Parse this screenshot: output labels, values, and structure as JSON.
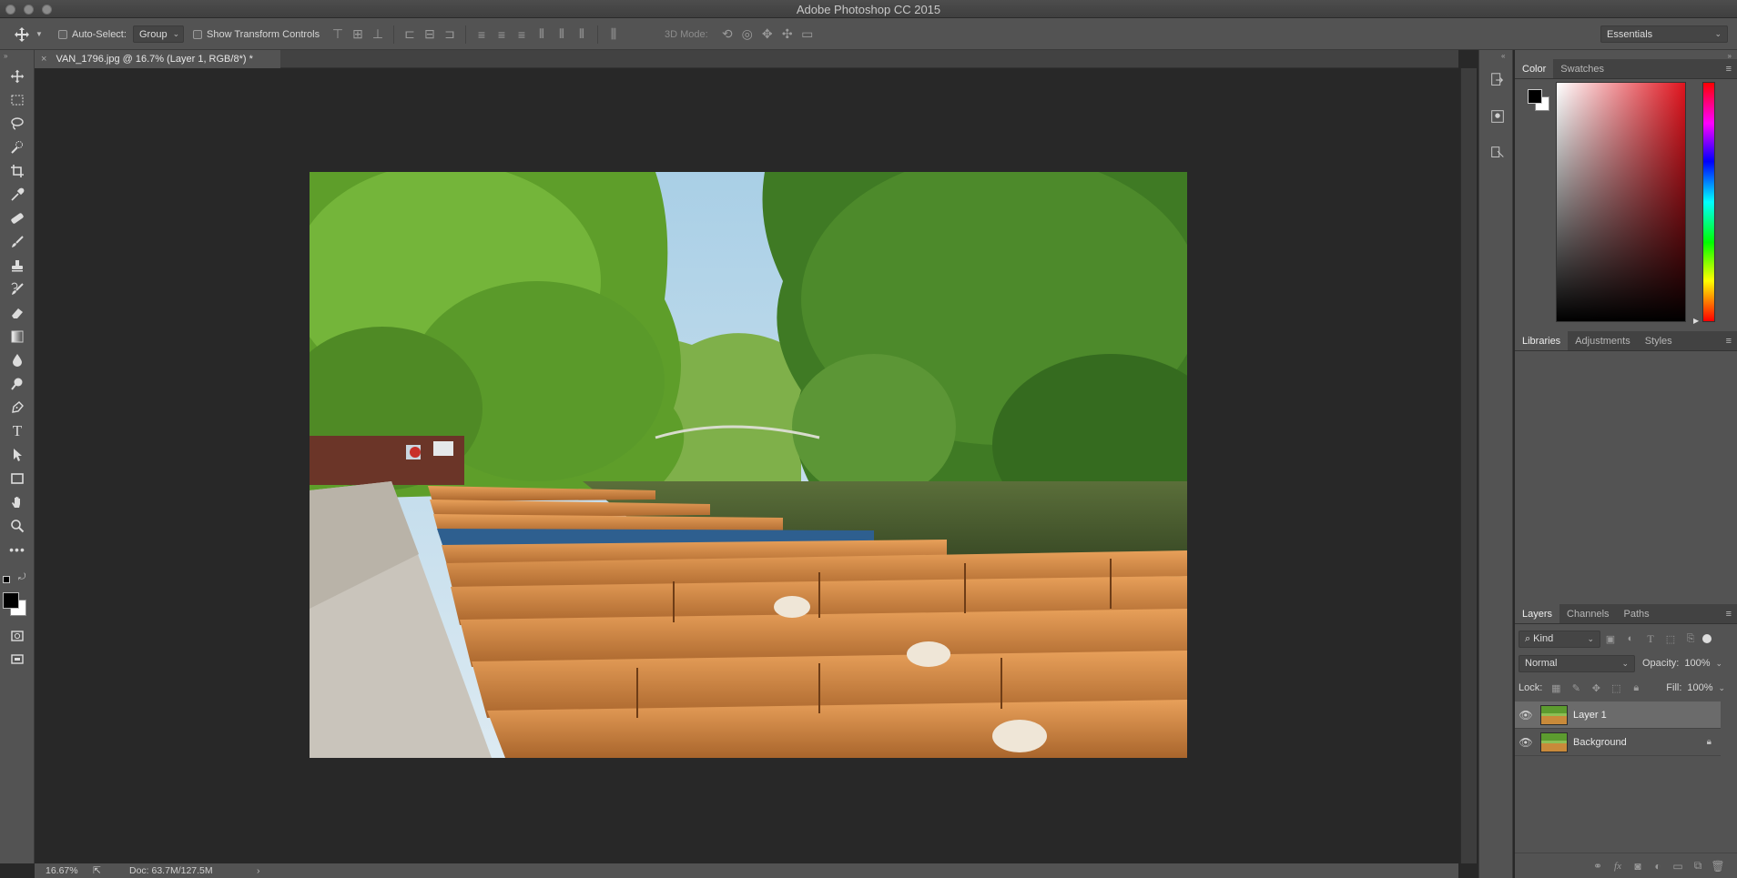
{
  "window": {
    "title": "Adobe Photoshop CC 2015"
  },
  "options_bar": {
    "auto_select_label": "Auto-Select:",
    "auto_select_value": "Group",
    "show_transform_label": "Show Transform Controls",
    "mode_3d_label": "3D Mode:",
    "workspace": "Essentials"
  },
  "document": {
    "tab_title": "VAN_1796.jpg @ 16.7% (Layer 1, RGB/8*) *"
  },
  "status": {
    "zoom": "16.67%",
    "doc_size": "Doc: 63.7M/127.5M"
  },
  "color_panel": {
    "tabs": [
      "Color",
      "Swatches"
    ],
    "foreground": "#000000",
    "background": "#ffffff",
    "hue_base": "#e0141e"
  },
  "libraries_panel": {
    "tabs": [
      "Libraries",
      "Adjustments",
      "Styles"
    ]
  },
  "layers_panel": {
    "tabs": [
      "Layers",
      "Channels",
      "Paths"
    ],
    "filter_kind": "Kind",
    "blend_mode": "Normal",
    "opacity_label": "Opacity:",
    "opacity_value": "100%",
    "lock_label": "Lock:",
    "fill_label": "Fill:",
    "fill_value": "100%",
    "layers": [
      {
        "name": "Layer 1",
        "selected": true,
        "locked": false
      },
      {
        "name": "Background",
        "selected": false,
        "locked": true
      }
    ],
    "footer_icons": [
      "link-icon",
      "fx-icon",
      "mask-icon",
      "adjustment-icon",
      "folder-icon",
      "new-layer-icon",
      "trash-icon"
    ]
  },
  "tools": [
    "move-tool-icon",
    "marquee-tool-icon",
    "lasso-tool-icon",
    "quick-select-tool-icon",
    "crop-tool-icon",
    "eyedropper-tool-icon",
    "healing-brush-tool-icon",
    "brush-tool-icon",
    "stamp-tool-icon",
    "history-brush-tool-icon",
    "eraser-tool-icon",
    "gradient-tool-icon",
    "blur-tool-icon",
    "dodge-tool-icon",
    "pen-tool-icon",
    "type-tool-icon",
    "path-select-tool-icon",
    "rectangle-tool-icon",
    "hand-tool-icon",
    "zoom-tool-icon",
    "more-tools-icon"
  ],
  "type_tool_glyph": "T",
  "fx_glyph": "fx"
}
